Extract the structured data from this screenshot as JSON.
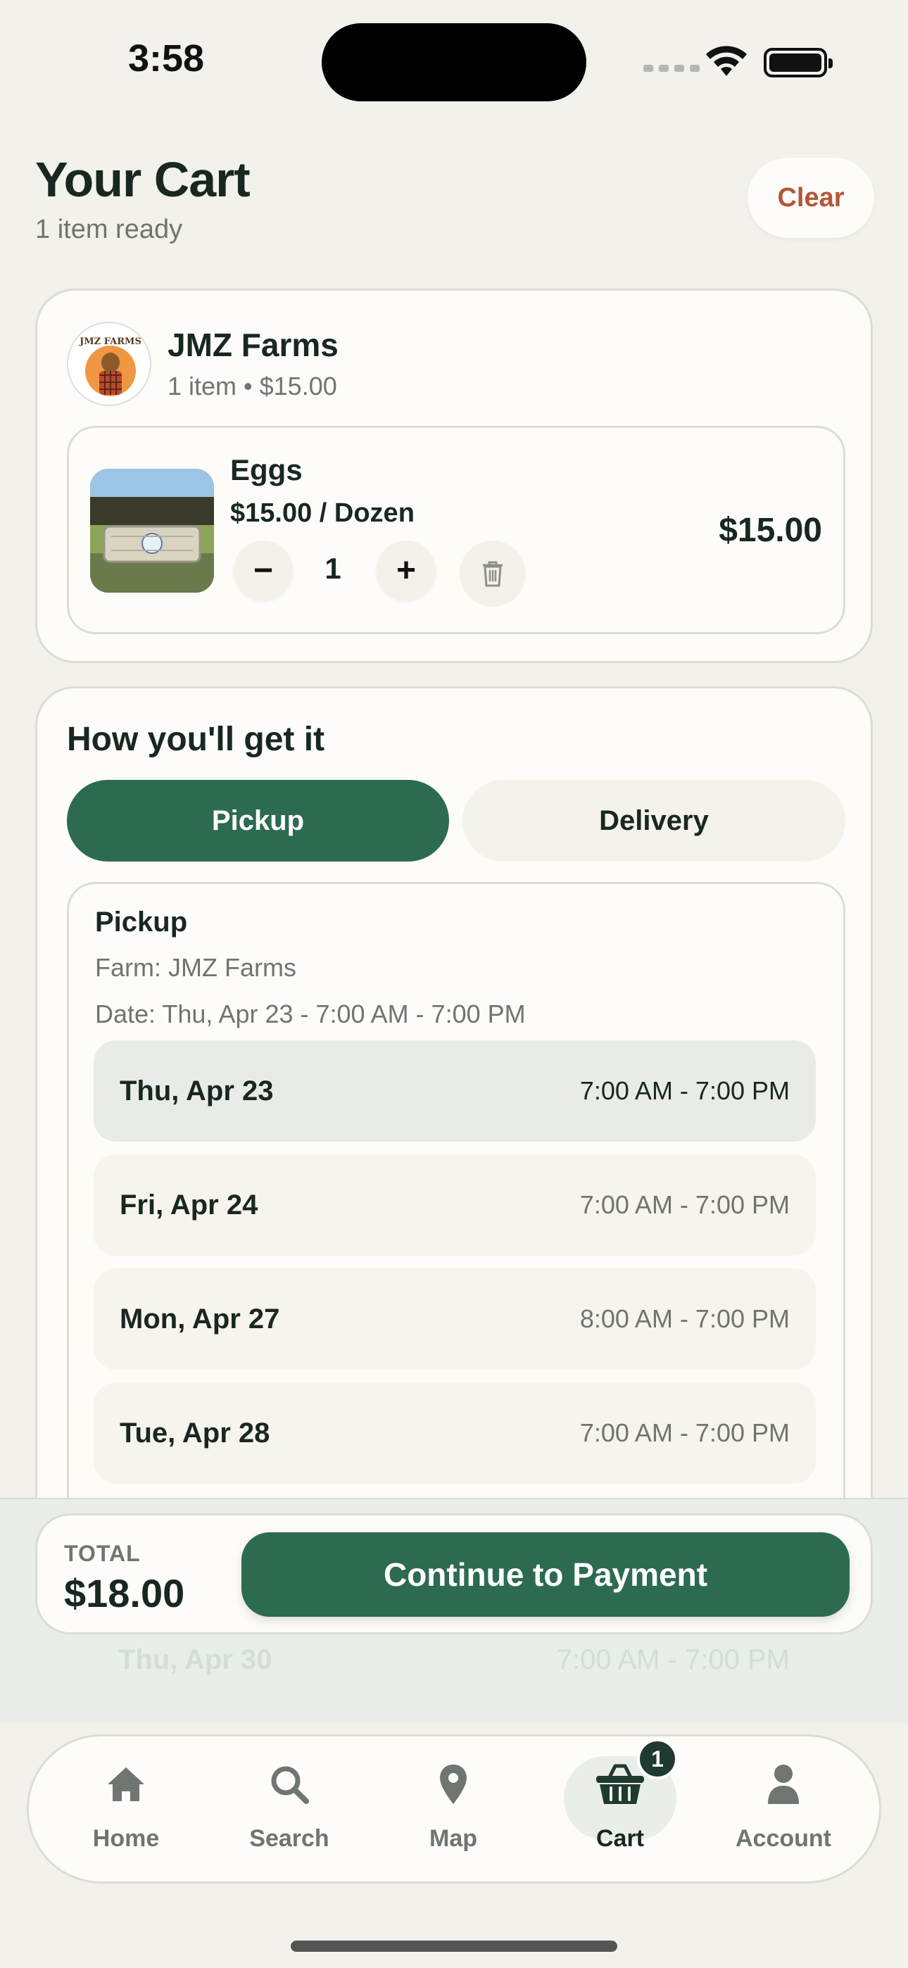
{
  "status_bar": {
    "time": "3:58"
  },
  "header": {
    "title": "Your Cart",
    "subtitle": "1 item ready",
    "clear_label": "Clear"
  },
  "farm": {
    "name": "JMZ Farms",
    "meta": "1 item • $15.00",
    "logo_text": "JMZ FARMS",
    "item": {
      "name": "Eggs",
      "price_unit": "$15.00 / Dozen",
      "quantity": "1",
      "minus_label": "−",
      "plus_label": "+",
      "line_total": "$15.00"
    }
  },
  "fulfillment": {
    "title": "How you'll get it",
    "options": [
      "Pickup",
      "Delivery"
    ],
    "selected": "Pickup",
    "pickup": {
      "heading": "Pickup",
      "farm": "Farm: JMZ Farms",
      "date": "Date: Thu, Apr 23 - 7:00 AM - 7:00 PM",
      "slots": [
        {
          "day": "Thu, Apr 23",
          "time": "7:00 AM - 7:00 PM",
          "selected": true
        },
        {
          "day": "Fri, Apr 24",
          "time": "7:00 AM - 7:00 PM",
          "selected": false
        },
        {
          "day": "Mon, Apr 27",
          "time": "8:00 AM - 7:00 PM",
          "selected": false
        },
        {
          "day": "Tue, Apr 28",
          "time": "7:00 AM - 7:00 PM",
          "selected": false
        },
        {
          "day": "Thu, Apr 30",
          "time": "7:00 AM - 7:00 PM",
          "selected": false
        }
      ]
    }
  },
  "checkout": {
    "total_label": "TOTAL",
    "total_value": "$18.00",
    "button_label": "Continue to Payment"
  },
  "tab_bar": {
    "tabs": [
      {
        "label": "Home",
        "icon": "home-icon"
      },
      {
        "label": "Search",
        "icon": "search-icon"
      },
      {
        "label": "Map",
        "icon": "map-pin-icon"
      },
      {
        "label": "Cart",
        "icon": "cart-icon",
        "active": true,
        "badge": "1"
      },
      {
        "label": "Account",
        "icon": "account-icon"
      }
    ]
  },
  "colors": {
    "accent": "#2c6b4f",
    "clear_text": "#b4553a",
    "background": "#f3f1ec"
  }
}
